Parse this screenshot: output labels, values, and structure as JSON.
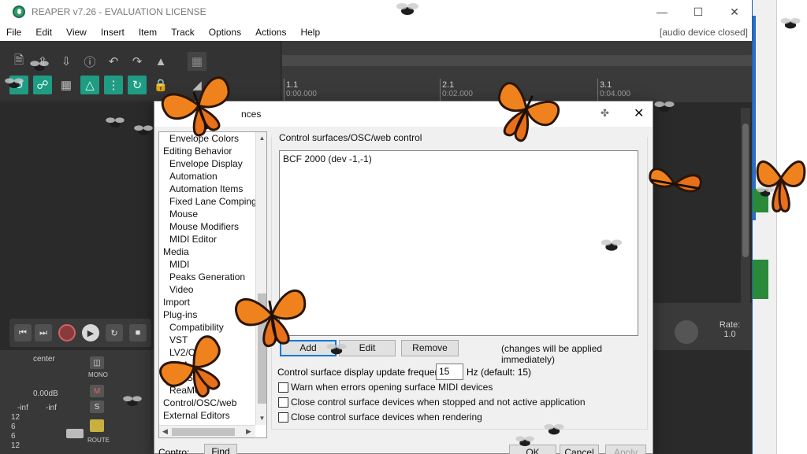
{
  "window": {
    "title": "REAPER v7.26 - EVALUATION LICENSE",
    "audio_status": "[audio device closed]"
  },
  "menu": [
    "File",
    "Edit",
    "View",
    "Insert",
    "Item",
    "Track",
    "Options",
    "Actions",
    "Help"
  ],
  "ruler": {
    "markers": [
      {
        "label": "1.1",
        "time": "0:00.000"
      },
      {
        "label": "2.1",
        "time": "0:02.000"
      },
      {
        "label": "3.1",
        "time": "0:04.000"
      }
    ]
  },
  "mixer": {
    "pan": "center",
    "volume": "0.00dB",
    "meter_left": "-inf",
    "meter_right": "-inf",
    "mono": "MONO",
    "mute": "M",
    "solo": "S",
    "route": "ROUTE",
    "scale": [
      "12",
      "6",
      "0",
      "6",
      "12",
      "18"
    ]
  },
  "rate": {
    "label": "Rate:",
    "value": "1.0"
  },
  "prefs": {
    "title": "nces",
    "tree": [
      {
        "label": "Envelope Colors",
        "level": 2
      },
      {
        "label": "Editing Behavior",
        "level": 1
      },
      {
        "label": "Envelope Display",
        "level": 2
      },
      {
        "label": "Automation",
        "level": 2
      },
      {
        "label": "Automation Items",
        "level": 2
      },
      {
        "label": "Fixed Lane Comping",
        "level": 2
      },
      {
        "label": "Mouse",
        "level": 2
      },
      {
        "label": "Mouse Modifiers",
        "level": 2
      },
      {
        "label": "MIDI Editor",
        "level": 2
      },
      {
        "label": "Media",
        "level": 1
      },
      {
        "label": "MIDI",
        "level": 2
      },
      {
        "label": "Peaks Generation",
        "level": 2
      },
      {
        "label": "Video",
        "level": 2
      },
      {
        "label": "Import",
        "level": 1
      },
      {
        "label": "Plug-ins",
        "level": 1
      },
      {
        "label": "Compatibility",
        "level": 2
      },
      {
        "label": "VST",
        "level": 2
      },
      {
        "label": "LV2/CLAP",
        "level": 2
      },
      {
        "label": "ARA",
        "level": 2
      },
      {
        "label": "ReaScript",
        "level": 2
      },
      {
        "label": "ReaMote",
        "level": 2
      },
      {
        "label": "Control/OSC/web",
        "level": 1
      },
      {
        "label": "External Editors",
        "level": 1
      }
    ],
    "find_label": "Contro:",
    "find_button": "Find",
    "section_label": "Control surfaces/OSC/web control",
    "surfaces": [
      "BCF 2000 (dev -1,-1)"
    ],
    "add_label": "Add",
    "edit_label": "Edit",
    "remove_label": "Remove",
    "note": "(changes will be applied immediately)",
    "freq_label": "Control surface display update frequency:",
    "freq_value": "15",
    "freq_hint": "Hz (default: 15)",
    "options": [
      "Warn when errors opening surface MIDI devices",
      "Close control surface devices when stopped and not active application",
      "Close control surface devices when rendering"
    ],
    "ok_label": "OK",
    "cancel_label": "Cancel",
    "apply_label": "Apply"
  }
}
